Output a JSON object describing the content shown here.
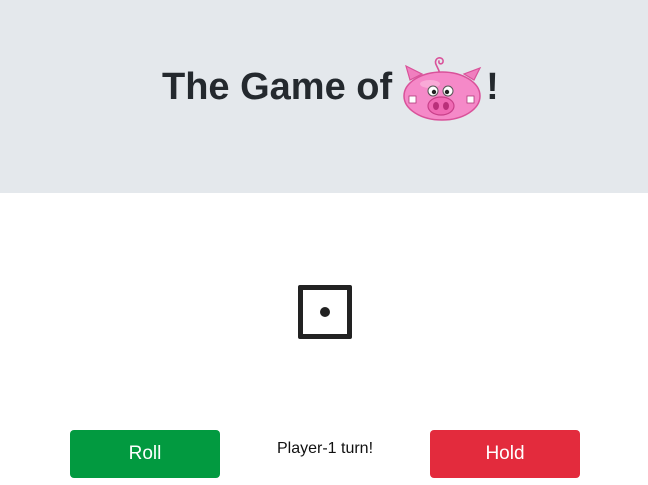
{
  "header": {
    "title_prefix": "The Game of ",
    "title_suffix": "!",
    "pig_icon": "pig-face-icon",
    "background": "#e4e8ec"
  },
  "die": {
    "value": 1,
    "icon": "die-face-one-icon"
  },
  "controls": {
    "roll_label": "Roll",
    "hold_label": "Hold",
    "roll_color": "#029a40",
    "hold_color": "#e32b3d"
  },
  "status": {
    "turn_text": "Player-1 turn!"
  }
}
